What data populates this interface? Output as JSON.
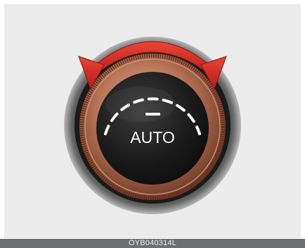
{
  "knob": {
    "mode_label": "AUTO",
    "rotation_arrow_icon": "double-headed-curved-arrow-icon",
    "arrow_color": "#d42a22",
    "ring_color": "#b06a4a",
    "face_color": "#1c1c1c",
    "indicator_color": "#ffffff"
  },
  "caption": {
    "code": "OYB040314L"
  }
}
